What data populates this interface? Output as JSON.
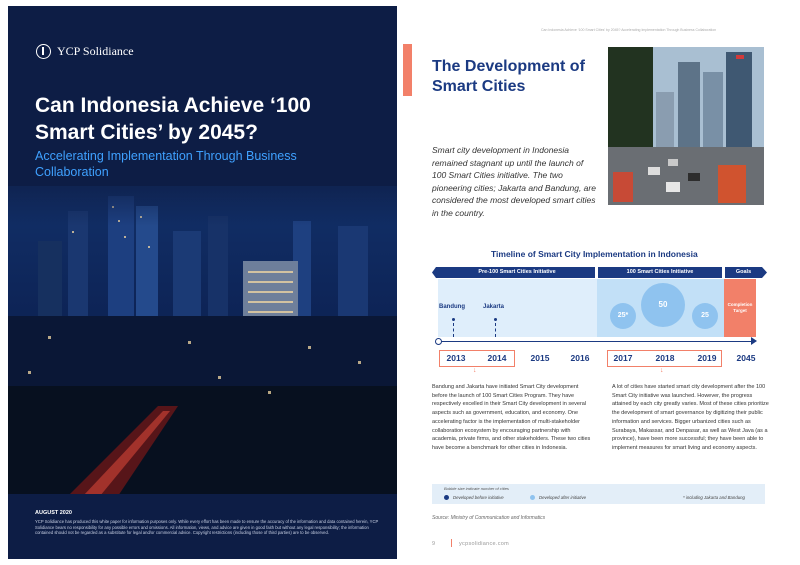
{
  "cover": {
    "logo_text": "YCP Solidiance",
    "title": "Can Indonesia Achieve ‘100 Smart Cities’ by 2045?",
    "subtitle": "Accelerating Implementation Through Business Collaboration",
    "date": "AUGUST 2020",
    "disclaimer": "YCP Solidiance has produced this white paper for information purposes only. While every effort has been made to ensure the accuracy of the information and data contained herein, YCP Solidiance bears no responsibility for any possible errors and omissions. All information, views, and advice are given in good faith but without any legal responsibility; the information contained should not be regarded as a substitute for legal and/or commercial advice. Copyright restrictions (including those of third parties) are to be observed."
  },
  "page": {
    "running_head": "Can Indonesia Achieve ‘100 Smart Cities’ by 2045? Accelerating Implementation Through Business Collaboration",
    "title": "The Development of Smart Cities",
    "intro": "Smart city development in Indonesia remained stagnant up until the launch of 100 Smart Cities initiative. The two pioneering cities; Jakarta and Bandung, are considered the most developed smart cities in the country.",
    "timeline": {
      "title": "Timeline of Smart City Implementation in Indonesia",
      "sections": [
        "Pre-100 Smart Cities Initiative",
        "100 Smart Cities Initiative",
        "Goals"
      ],
      "goal_label": "Completion Target",
      "years": [
        "2013",
        "2014",
        "2015",
        "2016",
        "2017",
        "2018",
        "2019",
        "2045"
      ],
      "pre_cities": [
        "Bandung",
        "Jakarta"
      ],
      "bubbles": [
        {
          "year": "2017",
          "value": 25,
          "label": "25*"
        },
        {
          "year": "2018",
          "value": 50,
          "label": "50"
        },
        {
          "year": "2019",
          "value": 25,
          "label": "25"
        }
      ]
    },
    "left_text": "Bandung and Jakarta have initiated Smart City development before the launch of 100 Smart Cities Program. They have respectively excelled in their Smart City development in several aspects such as government, education, and economy. One accelerating factor is the implementation of multi-stakeholder collaboration ecosystem by encouraging partnership with academia, private firms, and other stakeholders. These two cities have become a benchmark for other cities in Indonesia.",
    "right_text": "A lot of cities have started smart city development after the 100 Smart City initiative was launched. However, the progress attained by each city greatly varies. Most of these cities prioritize the development of smart governance by digitizing their public information and services. Bigger urbanized cities such as Surabaya, Makassar, and Denpasar, as well as West Java (as a province), have been more successful; they have been able to implement measures for smart living and economy aspects.",
    "legend": {
      "note": "Bubble size indicate number of cities",
      "before": "Developed before initiative",
      "after": "Developed after initiative",
      "footnote": "* including Jakarta and Bandung"
    },
    "source": "Source: Ministry of Communication and Informatics",
    "page_number": "9",
    "url": "ycpsolidiance.com"
  },
  "colors": {
    "navy": "#1b3a82",
    "coral": "#f28069",
    "light_blue": "#8fc3ef",
    "cover_bg": "#0d1d45"
  }
}
